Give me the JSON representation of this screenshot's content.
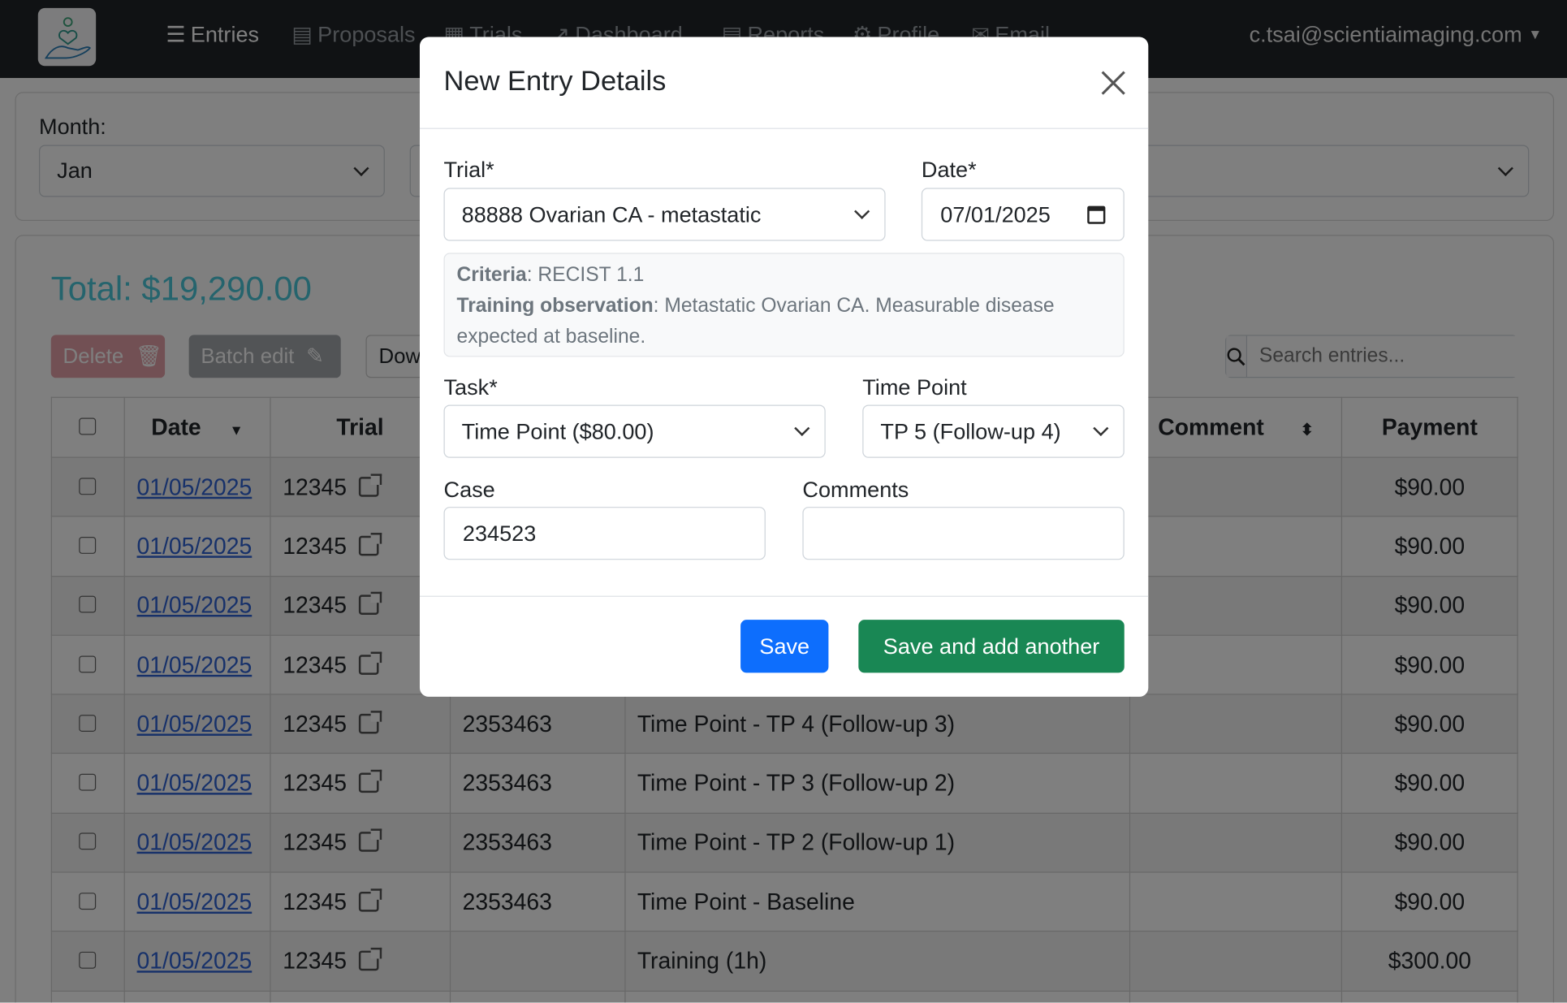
{
  "navbar": {
    "items": [
      {
        "label": "Entries",
        "icon": "list-check-icon",
        "active": true
      },
      {
        "label": "Proposals",
        "icon": "file-icon"
      },
      {
        "label": "Trials",
        "icon": "table-icon"
      },
      {
        "label": "Dashboard",
        "icon": "chart-line-icon"
      },
      {
        "label": "Reports",
        "icon": "file-icon"
      },
      {
        "label": "Profile",
        "icon": "gear-icon"
      },
      {
        "label": "Email",
        "icon": "envelope-icon"
      }
    ],
    "user": "c.tsai@scientiaimaging.com"
  },
  "filters": {
    "month_label": "Month:",
    "month_value": "Jan"
  },
  "summary": {
    "total": "Total: $19,290.00"
  },
  "toolbar": {
    "delete": "Delete",
    "batch_edit": "Batch edit",
    "download": "Dow",
    "search_placeholder": "Search entries..."
  },
  "table": {
    "headers": {
      "date": "Date",
      "trial": "Trial",
      "comment": "Comment",
      "payment": "Payment"
    },
    "rows": [
      {
        "date": "01/05/2025",
        "trial": "12345",
        "case": "",
        "task": "",
        "comment": "",
        "payment": "$90.00"
      },
      {
        "date": "01/05/2025",
        "trial": "12345",
        "case": "",
        "task": "",
        "comment": "",
        "payment": "$90.00"
      },
      {
        "date": "01/05/2025",
        "trial": "12345",
        "case": "",
        "task": "",
        "comment": "",
        "payment": "$90.00"
      },
      {
        "date": "01/05/2025",
        "trial": "12345",
        "case": "",
        "task": "",
        "comment": "",
        "payment": "$90.00"
      },
      {
        "date": "01/05/2025",
        "trial": "12345",
        "case": "2353463",
        "task": "Time Point - TP 4 (Follow-up 3)",
        "comment": "",
        "payment": "$90.00"
      },
      {
        "date": "01/05/2025",
        "trial": "12345",
        "case": "2353463",
        "task": "Time Point - TP 3 (Follow-up 2)",
        "comment": "",
        "payment": "$90.00"
      },
      {
        "date": "01/05/2025",
        "trial": "12345",
        "case": "2353463",
        "task": "Time Point - TP 2 (Follow-up 1)",
        "comment": "",
        "payment": "$90.00"
      },
      {
        "date": "01/05/2025",
        "trial": "12345",
        "case": "2353463",
        "task": "Time Point - Baseline",
        "comment": "",
        "payment": "$90.00"
      },
      {
        "date": "01/05/2025",
        "trial": "12345",
        "case": "",
        "task": "Training (1h)",
        "comment": "",
        "payment": "$300.00"
      }
    ]
  },
  "modal": {
    "title": "New Entry Details",
    "trial_label": "Trial*",
    "trial_value": "88888 Ovarian CA - metastatic",
    "date_label": "Date*",
    "date_value": "07/01/2025",
    "criteria_label": "Criteria",
    "criteria_value": ": RECIST 1.1",
    "observation_label": "Training observation",
    "observation_value": ": Metastatic Ovarian CA. Measurable disease expected at baseline.",
    "task_label": "Task*",
    "task_value": "Time Point ($80.00)",
    "timepoint_label": "Time Point",
    "timepoint_value": "TP 5 (Follow-up 4)",
    "case_label": "Case",
    "case_value": "234523",
    "comments_label": "Comments",
    "comments_value": "",
    "save": "Save",
    "save_another": "Save and add another"
  },
  "colors": {
    "primary": "#0d6efd",
    "success": "#198754",
    "danger": "#dc3545",
    "total": "#4bc8da",
    "navbar": "#212529"
  }
}
